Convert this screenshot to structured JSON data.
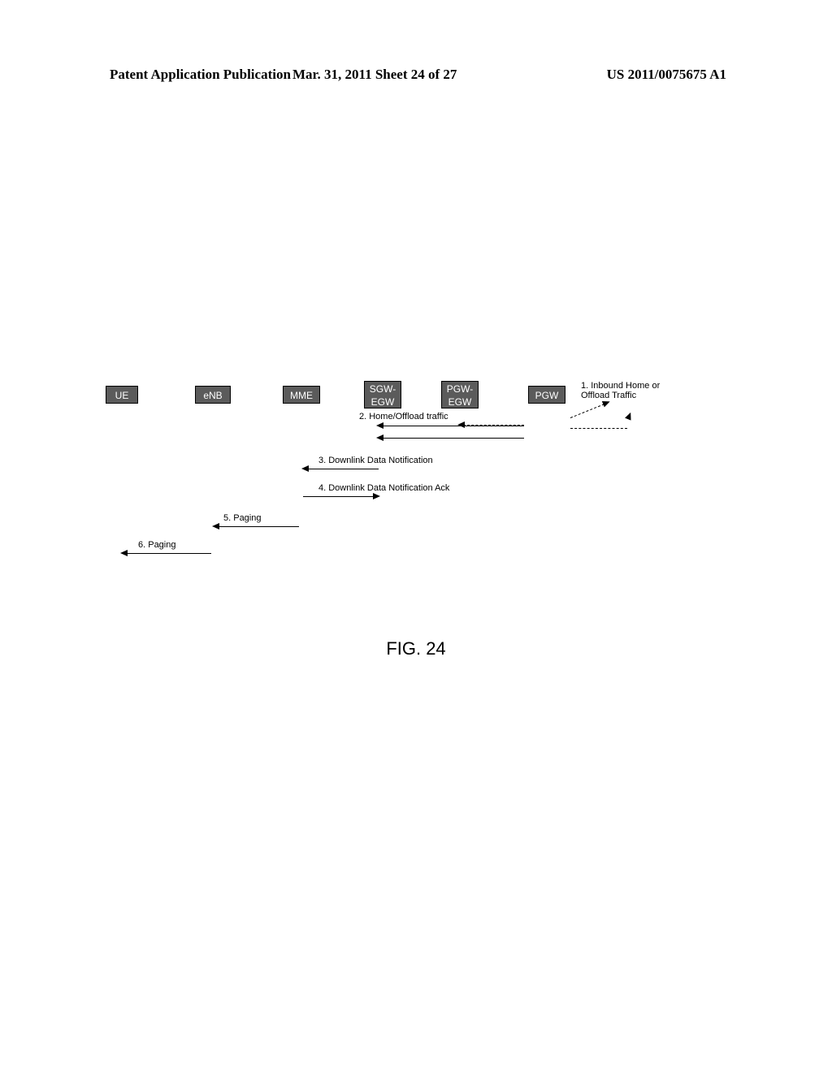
{
  "header": {
    "left": "Patent Application Publication",
    "center": "Mar. 31, 2011  Sheet 24 of 27",
    "right": "US 2011/0075675 A1"
  },
  "nodes": {
    "ue": "UE",
    "enb": "eNB",
    "mme": "MME",
    "sgw_egw": "SGW-\nEGW",
    "pgw_egw": "PGW-\nEGW",
    "pgw": "PGW"
  },
  "inbound_label": "1. Inbound Home or\nOffload Traffic",
  "messages": {
    "m2": "2. Home/Offload traffic",
    "m3": "3. Downlink Data Notification",
    "m4": "4. Downlink Data Notification Ack",
    "m5": "5. Paging",
    "m6": "6. Paging"
  },
  "figure_caption": "FIG. 24"
}
